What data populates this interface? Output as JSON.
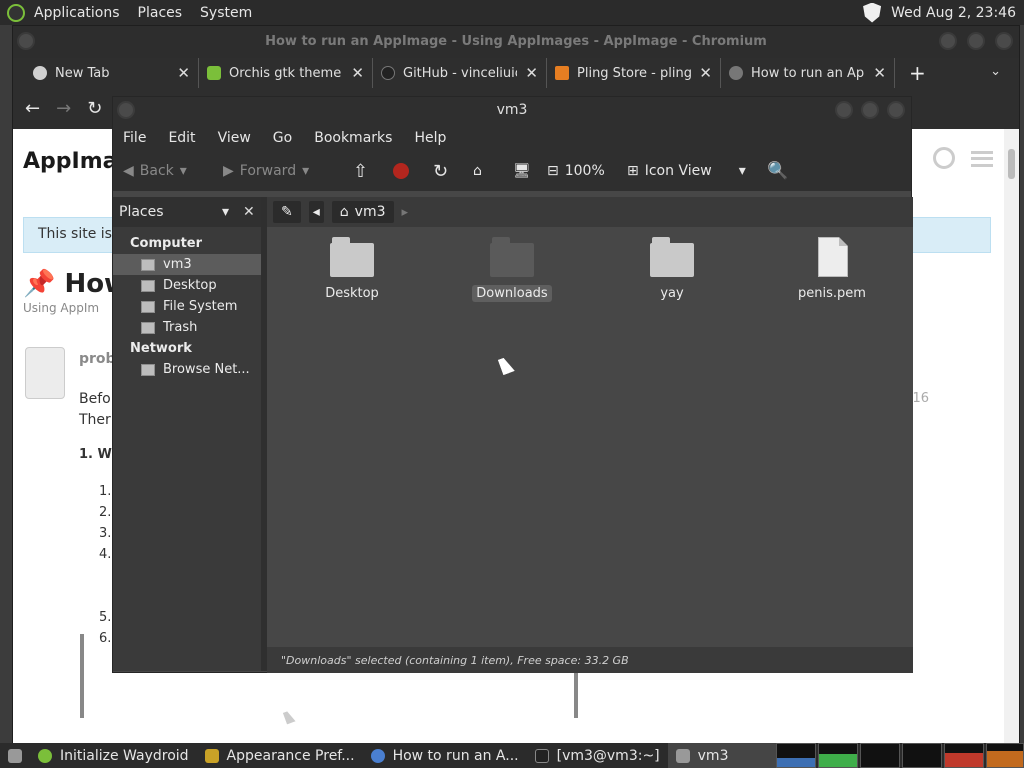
{
  "top_panel": {
    "menus": [
      "Applications",
      "Places",
      "System"
    ],
    "clock": "Wed Aug 2, 23:46"
  },
  "browser": {
    "title": "How to run an AppImage - Using AppImages - AppImage - Chromium",
    "tabs": [
      {
        "label": "New Tab",
        "icon_color": "#d0d0d0"
      },
      {
        "label": "Orchis gtk theme -",
        "icon_color": "#7bbf3a"
      },
      {
        "label": "GitHub - vinceliuice",
        "icon_color": "#222222"
      },
      {
        "label": "Pling Store - pling.",
        "icon_color": "#e67e22"
      },
      {
        "label": "How to run an App",
        "icon_color": "#777777"
      }
    ],
    "page": {
      "site_title": "AppImag",
      "notice": "This site is",
      "post_title": "How t",
      "breadcrumb": "Using AppIm",
      "author": "prob",
      "body_lines": [
        "Befo",
        "Ther"
      ],
      "date_fragment": "16",
      "step_heading": "1. W",
      "steps": [
        "1.",
        "2.",
        "3.",
        "4.",
        "",
        "",
        "5.",
        "6."
      ]
    }
  },
  "file_manager": {
    "window_title": "vm3",
    "menu": [
      "File",
      "Edit",
      "View",
      "Go",
      "Bookmarks",
      "Help"
    ],
    "toolbar": {
      "back": "Back",
      "forward": "Forward",
      "zoom": "100%",
      "view_mode": "Icon View"
    },
    "sidebar": {
      "selector": "Places",
      "sections": [
        {
          "title": "Computer",
          "items": [
            "vm3",
            "Desktop",
            "File System",
            "Trash"
          ]
        },
        {
          "title": "Network",
          "items": [
            "Browse Net..."
          ]
        }
      ]
    },
    "path": {
      "current": "vm3"
    },
    "files": [
      {
        "name": "Desktop",
        "type": "folder"
      },
      {
        "name": "Downloads",
        "type": "folder-selected"
      },
      {
        "name": "yay",
        "type": "folder"
      },
      {
        "name": "penis.pem",
        "type": "file"
      }
    ],
    "status": "\"Downloads\" selected (containing 1 item), Free space: 33.2 GB"
  },
  "taskbar": {
    "tasks": [
      "Initialize Waydroid",
      "Appearance Pref...",
      "How to run an A...",
      "[vm3@vm3:~]",
      "vm3"
    ]
  }
}
